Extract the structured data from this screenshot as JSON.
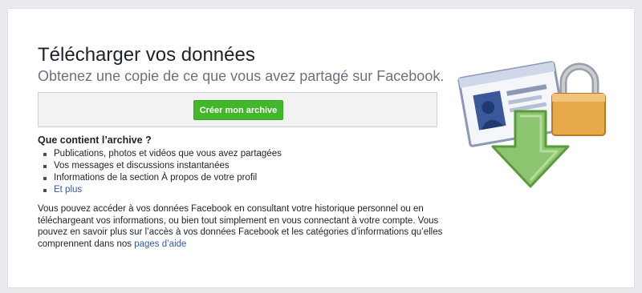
{
  "page": {
    "title": "Télécharger vos données",
    "subtitle": "Obtenez une copie de ce que vous avez partagé sur Facebook."
  },
  "actions": {
    "create_archive_label": "Créer mon archive"
  },
  "archive_contents": {
    "heading": "Que contient l’archive ?",
    "items": [
      "Publications, photos et vidéos que vous avez partagées",
      "Vos messages et discussions instantanées",
      "Informations de la section À propos de votre profil"
    ],
    "more_link": "Et plus"
  },
  "info": {
    "text": "Vous pouvez accéder à vos données Facebook en consultant votre historique personnel ou en téléchargeant vos informations, ou bien tout simplement en vous connectant à votre compte. Vous pouvez en savoir plus sur l’accès à vos données Facebook et les catégories d’informations qu’elles comprennent dans nos ",
    "help_link": "pages d’aide"
  },
  "illustration": {
    "icons": [
      "id-card-icon",
      "padlock-icon",
      "download-arrow-icon"
    ]
  },
  "colors": {
    "button_green": "#42b72a",
    "link_blue": "#365899",
    "arrow_green": "#8cc56f",
    "lock_orange": "#e8a94a"
  }
}
